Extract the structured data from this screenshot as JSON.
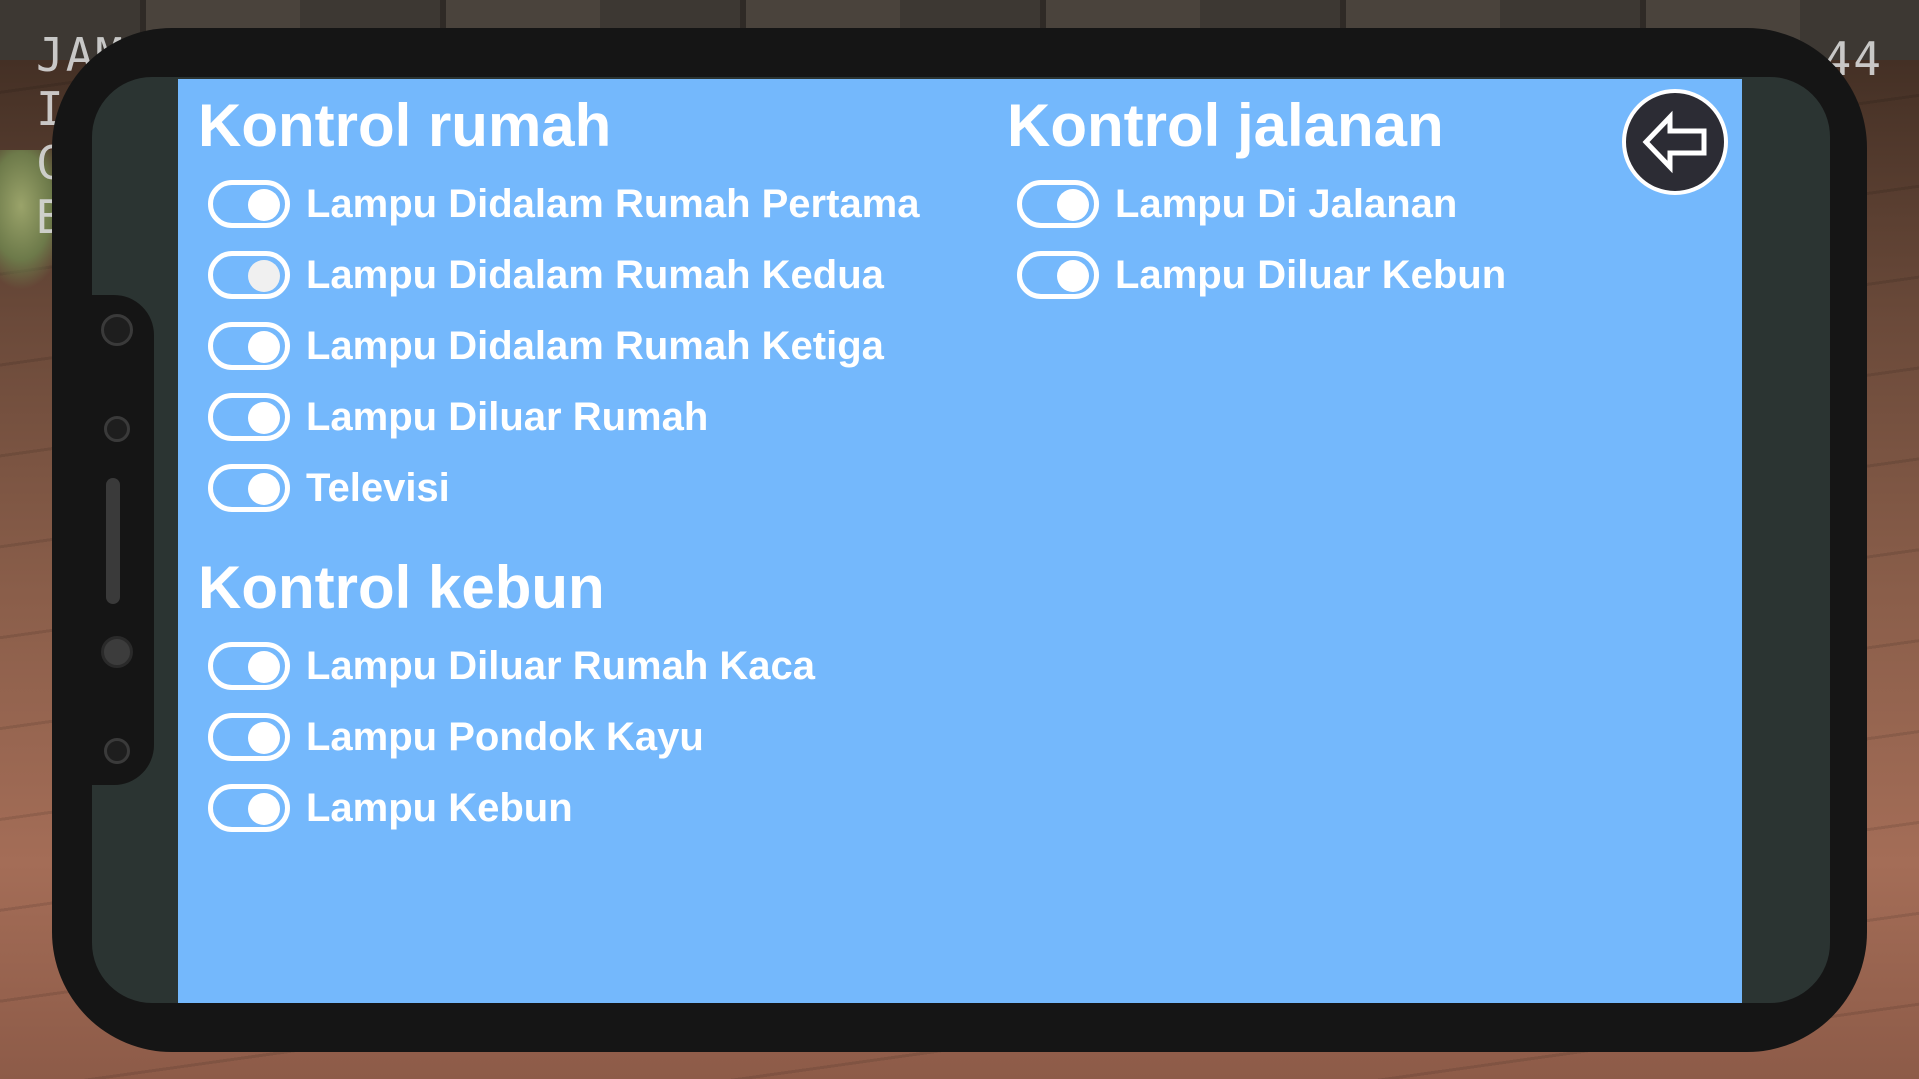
{
  "background": {
    "hud_left_lines": [
      "JAM",
      "I",
      "C",
      "B"
    ],
    "hud_right_text": "44"
  },
  "sections": {
    "rumah": {
      "title": "Kontrol rumah",
      "items": [
        {
          "label": "Lampu Didalam Rumah Pertama",
          "on": true
        },
        {
          "label": "Lampu Didalam Rumah Kedua",
          "on": true
        },
        {
          "label": "Lampu Didalam Rumah Ketiga",
          "on": true
        },
        {
          "label": "Lampu Diluar Rumah",
          "on": true
        },
        {
          "label": "Televisi",
          "on": true
        }
      ]
    },
    "kebun": {
      "title": "Kontrol kebun",
      "items": [
        {
          "label": "Lampu Diluar Rumah Kaca",
          "on": true
        },
        {
          "label": "Lampu Pondok Kayu",
          "on": true
        },
        {
          "label": "Lampu Kebun",
          "on": true
        }
      ]
    },
    "jalanan": {
      "title": "Kontrol jalanan",
      "items": [
        {
          "label": "Lampu Di Jalanan",
          "on": true
        },
        {
          "label": "Lampu Diluar Kebun",
          "on": true
        }
      ]
    }
  },
  "back_button": {
    "icon": "arrow-left-icon"
  },
  "colors": {
    "screen_background": "#74b8fc",
    "text": "#ffffff",
    "phone_frame": "#151515",
    "back_button_fill": "#2c2c34"
  }
}
